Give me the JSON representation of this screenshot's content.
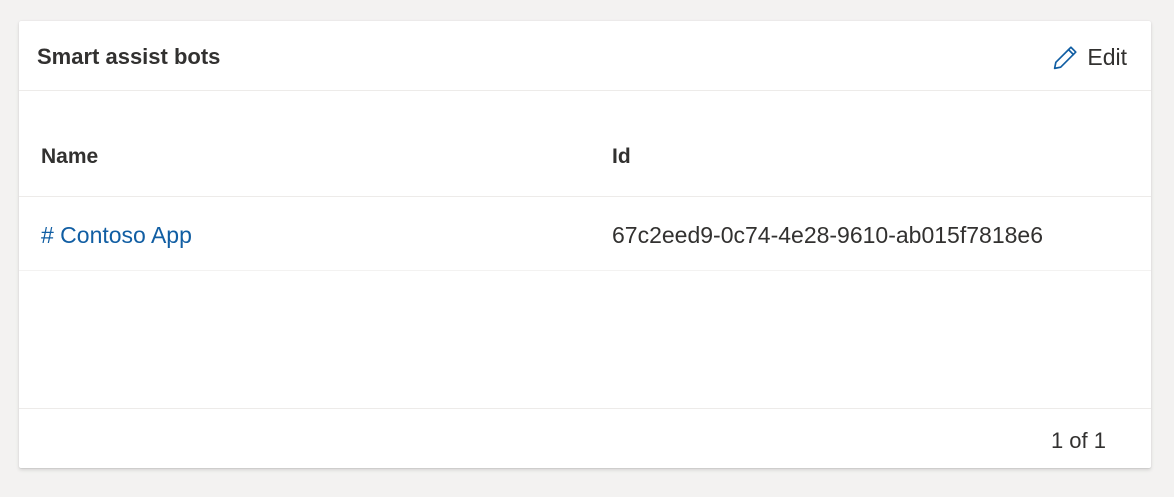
{
  "card": {
    "title": "Smart assist bots",
    "edit_label": "Edit",
    "edit_icon": "pencil-icon"
  },
  "table": {
    "columns": [
      "Name",
      "Id"
    ],
    "rows": [
      {
        "name": "# Contoso App",
        "id": "67c2eed9-0c74-4e28-9610-ab015f7818e6"
      }
    ]
  },
  "footer": {
    "pagination": "1 of 1"
  },
  "colors": {
    "background": "#f3f2f1",
    "card": "#ffffff",
    "link": "#115ea3",
    "text": "#323130",
    "divider": "#edebe9"
  }
}
